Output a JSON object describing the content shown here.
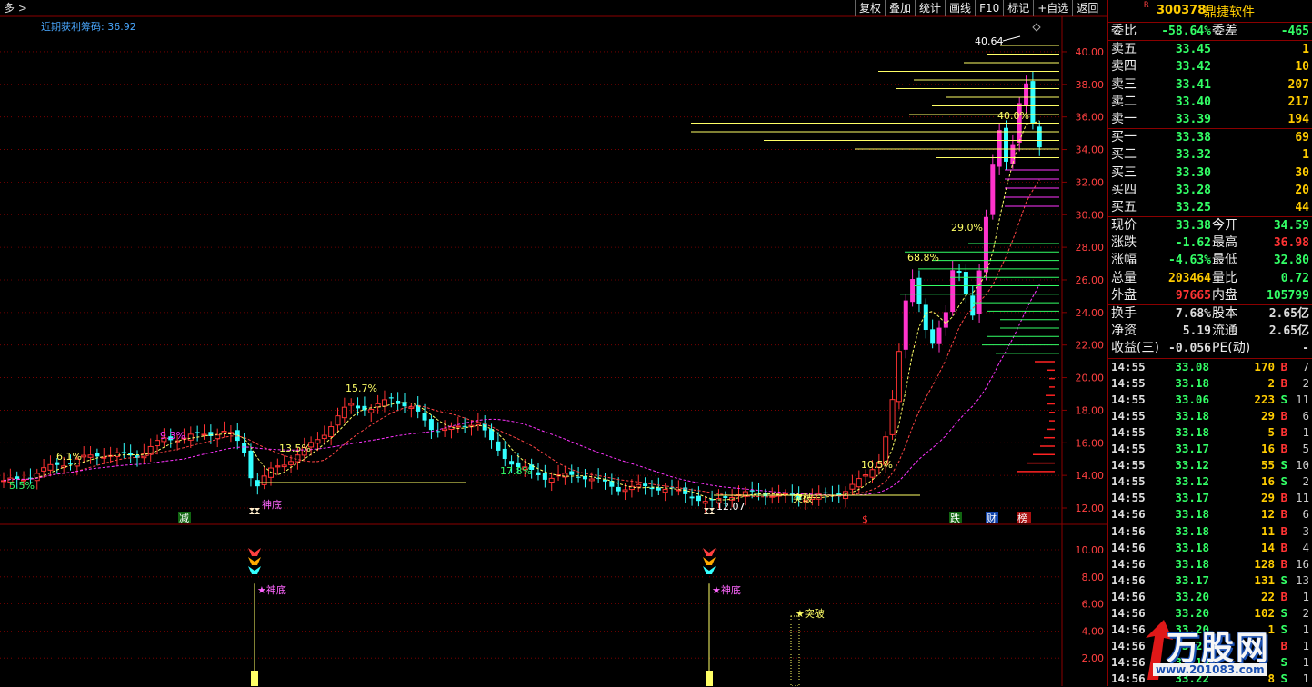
{
  "toolbar": {
    "dropdown": "多 >",
    "buttons": [
      "复权",
      "叠加",
      "统计",
      "画线",
      "F10",
      "标记",
      "+自选",
      "返回"
    ]
  },
  "indicator_label": "近期获利筹码: 36.92",
  "main_y_ticks": [
    "40.00",
    "38.00",
    "36.00",
    "34.00",
    "32.00",
    "30.00",
    "28.00",
    "26.00",
    "24.00",
    "22.00",
    "20.00",
    "18.00",
    "16.00",
    "14.00",
    "12.00"
  ],
  "sub_y_ticks": [
    "10.00",
    "8.00",
    "6.00",
    "4.00",
    "2.00"
  ],
  "price_annotations": {
    "high_label": "40.64",
    "low_label": "12.07",
    "pct_labels": [
      "5.5%",
      "6.1%",
      "9.3%",
      "15.7%",
      "13.5%",
      "17.8%",
      "10.5%",
      "68.8%",
      "29.0%",
      "40.0%"
    ]
  },
  "signals": {
    "shendi": "神底",
    "tupo": "突破",
    "jian": "减",
    "die": "跌",
    "cai": "财",
    "bang": "榜",
    "dollar": "$",
    "sub_shendi": "★神底",
    "sub_tupo": "★突破"
  },
  "stock": {
    "r_mark": "R",
    "code": "300378",
    "name": "鼎捷软件"
  },
  "weibi": {
    "label": "委比",
    "value": "-58.64%",
    "label2": "委差",
    "value2": "-465"
  },
  "asks": [
    {
      "label": "卖五",
      "price": "33.45",
      "vol": "1"
    },
    {
      "label": "卖四",
      "price": "33.42",
      "vol": "10"
    },
    {
      "label": "卖三",
      "price": "33.41",
      "vol": "207"
    },
    {
      "label": "卖二",
      "price": "33.40",
      "vol": "217"
    },
    {
      "label": "卖一",
      "price": "33.39",
      "vol": "194"
    }
  ],
  "bids": [
    {
      "label": "买一",
      "price": "33.38",
      "vol": "69"
    },
    {
      "label": "买二",
      "price": "33.32",
      "vol": "1"
    },
    {
      "label": "买三",
      "price": "33.30",
      "vol": "30"
    },
    {
      "label": "买四",
      "price": "33.28",
      "vol": "20"
    },
    {
      "label": "买五",
      "price": "33.25",
      "vol": "44"
    }
  ],
  "quote": [
    {
      "l1": "现价",
      "v1": "33.38",
      "c1": "g",
      "l2": "今开",
      "v2": "34.59",
      "c2": "g"
    },
    {
      "l1": "涨跌",
      "v1": "-1.62",
      "c1": "g",
      "l2": "最高",
      "v2": "36.98",
      "c2": "r"
    },
    {
      "l1": "涨幅",
      "v1": "-4.63%",
      "c1": "g",
      "l2": "最低",
      "v2": "32.80",
      "c2": "g"
    },
    {
      "l1": "总量",
      "v1": "203464",
      "c1": "y",
      "l2": "量比",
      "v2": "0.72",
      "c2": "g"
    },
    {
      "l1": "外盘",
      "v1": "97665",
      "c1": "r",
      "l2": "内盘",
      "v2": "105799",
      "c2": "g"
    }
  ],
  "fundamentals": [
    {
      "l1": "换手",
      "v1": "7.68%",
      "l2": "股本",
      "v2": "2.65亿"
    },
    {
      "l1": "净资",
      "v1": "5.19",
      "l2": "流通",
      "v2": "2.65亿"
    },
    {
      "l1": "收益(三)",
      "v1": "-0.056",
      "l2": "PE(动)",
      "v2": "-"
    }
  ],
  "ticks": [
    {
      "time": "14:55",
      "price": "33.08",
      "vol": "170",
      "bs": "B",
      "n": "7"
    },
    {
      "time": "14:55",
      "price": "33.18",
      "vol": "2",
      "bs": "B",
      "n": "2"
    },
    {
      "time": "14:55",
      "price": "33.06",
      "vol": "223",
      "bs": "S",
      "n": "11"
    },
    {
      "time": "14:55",
      "price": "33.18",
      "vol": "29",
      "bs": "B",
      "n": "6"
    },
    {
      "time": "14:55",
      "price": "33.18",
      "vol": "5",
      "bs": "B",
      "n": "1"
    },
    {
      "time": "14:55",
      "price": "33.17",
      "vol": "16",
      "bs": "B",
      "n": "5"
    },
    {
      "time": "14:55",
      "price": "33.12",
      "vol": "55",
      "bs": "S",
      "n": "10"
    },
    {
      "time": "14:55",
      "price": "33.12",
      "vol": "16",
      "bs": "S",
      "n": "2"
    },
    {
      "time": "14:55",
      "price": "33.17",
      "vol": "29",
      "bs": "B",
      "n": "11"
    },
    {
      "time": "14:56",
      "price": "33.18",
      "vol": "12",
      "bs": "B",
      "n": "6"
    },
    {
      "time": "14:56",
      "price": "33.18",
      "vol": "11",
      "bs": "B",
      "n": "3"
    },
    {
      "time": "14:56",
      "price": "33.18",
      "vol": "14",
      "bs": "B",
      "n": "4"
    },
    {
      "time": "14:56",
      "price": "33.18",
      "vol": "128",
      "bs": "B",
      "n": "16"
    },
    {
      "time": "14:56",
      "price": "33.17",
      "vol": "131",
      "bs": "S",
      "n": "13"
    },
    {
      "time": "14:56",
      "price": "33.20",
      "vol": "22",
      "bs": "B",
      "n": "1"
    },
    {
      "time": "14:56",
      "price": "33.20",
      "vol": "102",
      "bs": "S",
      "n": "2"
    },
    {
      "time": "14:56",
      "price": "33.20",
      "vol": "1",
      "bs": "S",
      "n": "1"
    },
    {
      "time": "14:56",
      "price": "33.20",
      "vol": "",
      "bs": "B",
      "n": "1"
    },
    {
      "time": "14:56",
      "price": "33.19",
      "vol": "",
      "bs": "S",
      "n": "1"
    },
    {
      "time": "14:56",
      "price": "33.22",
      "vol": "8",
      "bs": "S",
      "n": "1"
    }
  ],
  "watermark": {
    "text": "万股网",
    "url": "www.201083.com"
  },
  "colors": {
    "up": "#ff3333",
    "down": "#33ffff",
    "bull": "#ff33cc",
    "grid": "#8b0000",
    "yellow": "#ffff66",
    "green": "#33ff66"
  }
}
